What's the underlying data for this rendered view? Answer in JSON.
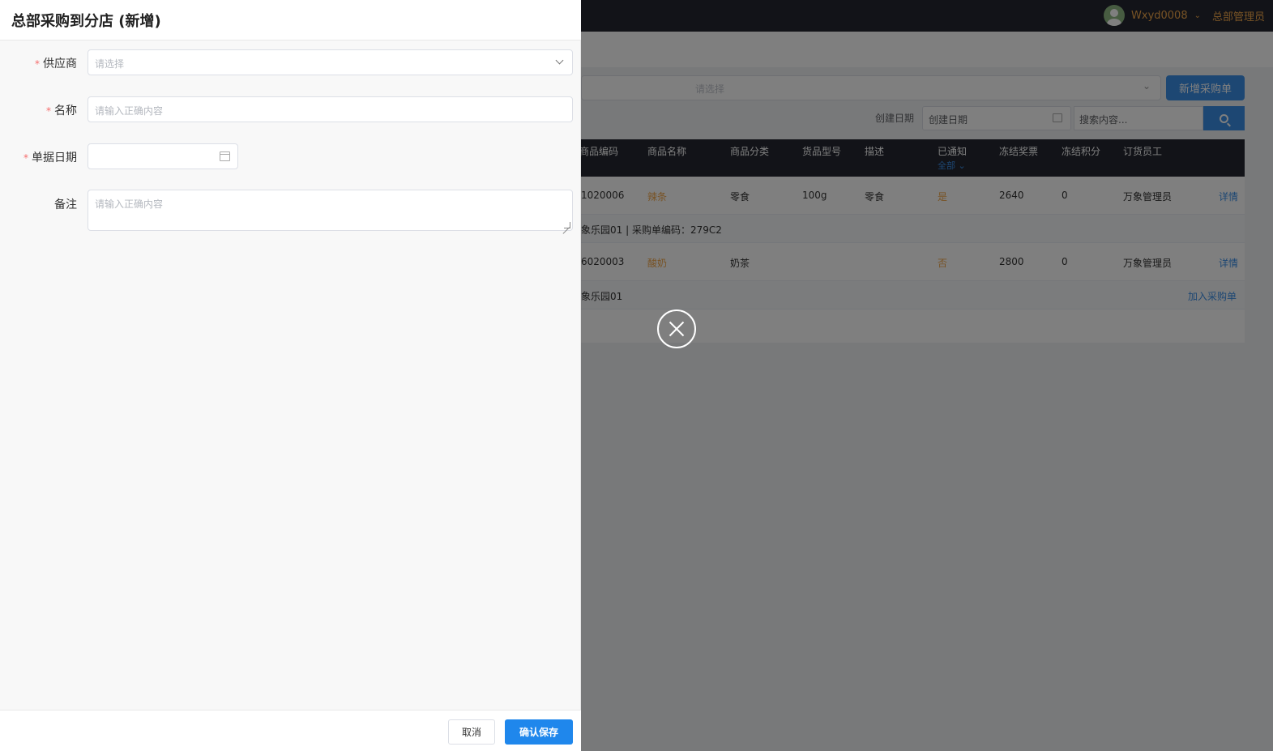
{
  "topbar": {
    "username": "Wxyd0008",
    "role": "总部管理员"
  },
  "background": {
    "filter_placeholder": "请选择",
    "new_button": "新增采购单",
    "date_label": "创建日期",
    "date_placeholder": "创建日期",
    "search_placeholder": "搜索内容...",
    "columns": [
      "商品编码",
      "商品名称",
      "商品分类",
      "货品型号",
      "描述",
      "已通知",
      "冻结奖票",
      "冻结积分",
      "订货员工"
    ],
    "notified_filter": "全部",
    "rows": [
      {
        "code": "1020006",
        "name": "辣条",
        "category": "零食",
        "model": "100g",
        "desc": "零食",
        "notified": "是",
        "frozen_tickets": "2640",
        "frozen_points": "0",
        "staff": "万象管理员",
        "action": "详情"
      },
      {
        "code": "6020003",
        "name": "酸奶",
        "category": "奶茶",
        "model": "",
        "desc": "",
        "notified": "否",
        "frozen_tickets": "2800",
        "frozen_points": "0",
        "staff": "万象管理员",
        "action": "详情"
      }
    ],
    "subrows": [
      {
        "text": "象乐园01  | 采购单编码：279C2",
        "link": ""
      },
      {
        "text": "象乐园01",
        "link": "加入采购单"
      }
    ]
  },
  "drawer": {
    "title": "总部采购到分店 (新增)",
    "supplier_label": "供应商",
    "supplier_placeholder": "请选择",
    "name_label": "名称",
    "name_placeholder": "请输入正确内容",
    "date_label": "单据日期",
    "date_value": "",
    "remark_label": "备注",
    "remark_placeholder": "请输入正确内容",
    "required_mark": "*",
    "cancel": "取消",
    "save": "确认保存"
  }
}
